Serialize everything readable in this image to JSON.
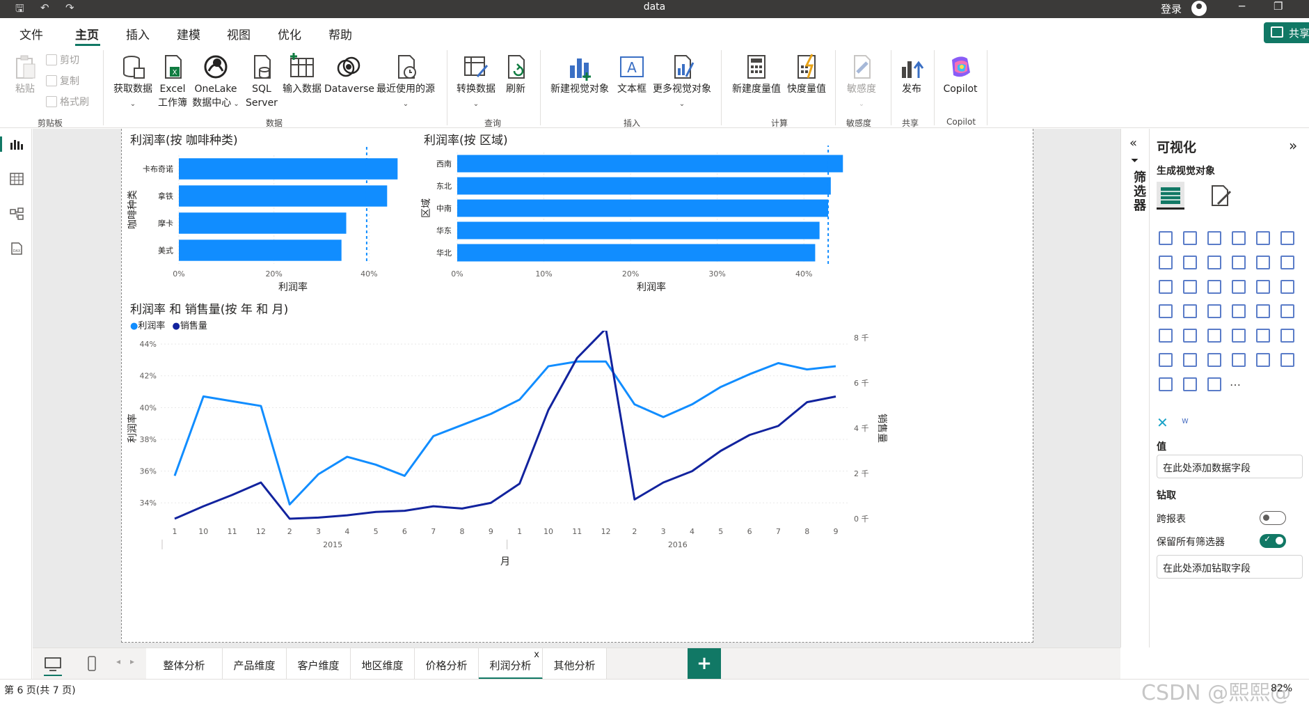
{
  "window": {
    "title": "data",
    "login": "登录"
  },
  "menu": {
    "file": "文件",
    "home": "主页",
    "insert": "插入",
    "model": "建模",
    "view": "视图",
    "optimize": "优化",
    "help": "帮助",
    "share": "共享"
  },
  "ribbon": {
    "paste": "粘贴",
    "cut": "剪切",
    "copy": "复制",
    "format_painter": "格式刷",
    "get_data": "获取数据",
    "excel_l1": "Excel",
    "excel_l2": "工作簿",
    "onelake_l1": "OneLake",
    "onelake_l2": "数据中心",
    "sql_l1": "SQL",
    "sql_l2": "Server",
    "enter_data": "输入数据",
    "dataverse": "Dataverse",
    "recent_sources": "最近使用的源",
    "transform_data": "转换数据",
    "refresh": "刷新",
    "new_visual": "新建视觉对象",
    "text_box": "文本框",
    "more_visuals": "更多视觉对象",
    "new_measure": "新建度量值",
    "quick_measure": "快度量值",
    "sensitivity": "敏感度",
    "publish": "发布",
    "copilot": "Copilot",
    "groups": {
      "clipboard": "剪贴板",
      "data": "数据",
      "query": "查询",
      "insert": "插入",
      "calc": "计算",
      "sensitivity": "敏感度",
      "share": "共享",
      "copilot": "Copilot"
    }
  },
  "filters": {
    "label": "筛选器"
  },
  "vispane": {
    "title": "可视化",
    "build_visual": "生成视觉对象",
    "values_label": "值",
    "values_placeholder": "在此处添加数据字段",
    "drill_label": "钻取",
    "cross_report": "跨报表",
    "keep_filters": "保留所有筛选器",
    "drill_placeholder": "在此处添加钻取字段",
    "cross_report_on": false,
    "keep_filters_on": true
  },
  "tabs": [
    "整体分析",
    "产品维度",
    "客户维度",
    "地区维度",
    "价格分析",
    "利润分析",
    "其他分析"
  ],
  "active_tab": "利润分析",
  "status": {
    "page": "第 6 页(共 7 页)",
    "zoom": "82%",
    "watermark": "CSDN @熙熙@"
  },
  "chart_data": [
    {
      "type": "bar",
      "title": "利润率(按 咖啡种类)",
      "xlabel": "利润率",
      "ylabel": "咖啡种类",
      "categories": [
        "卡布奇诺",
        "拿铁",
        "摩卡",
        "美式"
      ],
      "values": [
        46.0,
        43.8,
        35.2,
        34.2
      ],
      "xlim": [
        0,
        48
      ],
      "xticks": [
        "0%",
        "20%",
        "40%"
      ],
      "xtick_values": [
        0,
        20,
        40
      ],
      "reference_line": 39.5,
      "color": "#118dff"
    },
    {
      "type": "bar",
      "title": "利润率(按 区域)",
      "xlabel": "利润率",
      "ylabel": "区域",
      "categories": [
        "西南",
        "东北",
        "中南",
        "华东",
        "华北"
      ],
      "values": [
        44.5,
        43.1,
        42.8,
        41.8,
        41.3
      ],
      "xlim": [
        0,
        44.8
      ],
      "xticks": [
        "0%",
        "10%",
        "20%",
        "30%",
        "40%"
      ],
      "xtick_values": [
        0,
        10,
        20,
        30,
        40
      ],
      "reference_line": 42.8,
      "color": "#118dff"
    },
    {
      "type": "line",
      "title": "利润率 和 销售量(按 年 和 月)",
      "xlabel": "月",
      "ylabel": "利润率",
      "y2label": "销售量",
      "x": [
        "1",
        "10",
        "11",
        "12",
        "2",
        "3",
        "4",
        "5",
        "6",
        "7",
        "8",
        "9",
        "1",
        "10",
        "11",
        "12",
        "2",
        "3",
        "4",
        "5",
        "6",
        "7",
        "8",
        "9"
      ],
      "year_groups": [
        {
          "label": "2015",
          "from": 0,
          "to": 11
        },
        {
          "label": "2016",
          "from": 12,
          "to": 23
        }
      ],
      "series": [
        {
          "name": "利润率",
          "axis": "left",
          "color": "#118dff",
          "values": [
            35.7,
            40.7,
            40.4,
            40.1,
            33.9,
            35.8,
            36.9,
            36.4,
            35.7,
            38.2,
            38.9,
            39.6,
            40.5,
            42.6,
            42.9,
            42.9,
            40.2,
            39.4,
            40.2,
            41.3,
            42.1,
            42.8,
            42.4,
            42.6
          ]
        },
        {
          "name": "销售量",
          "axis": "right",
          "color": "#12239e",
          "values": [
            0,
            550,
            1050,
            1600,
            0,
            50,
            150,
            300,
            350,
            550,
            450,
            700,
            1550,
            4800,
            7100,
            8400,
            850,
            1600,
            2100,
            3000,
            3700,
            4100,
            5150,
            5400
          ]
        }
      ],
      "ylim": [
        33,
        44.4
      ],
      "yticks": [
        "34%",
        "36%",
        "38%",
        "40%",
        "42%",
        "44%"
      ],
      "ytick_values": [
        34,
        36,
        38,
        40,
        42,
        44
      ],
      "y2lim": [
        0,
        8000
      ],
      "y2ticks": [
        "0 千",
        "2 千",
        "4 千",
        "6 千",
        "8 千"
      ],
      "y2tick_values": [
        0,
        2000,
        4000,
        6000,
        8000
      ]
    }
  ]
}
